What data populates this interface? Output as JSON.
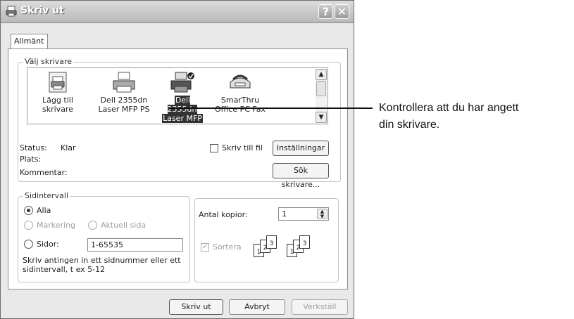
{
  "dialog": {
    "title": "Skriv ut",
    "help_label": "?",
    "close_label": "✕",
    "tab": "Allmänt"
  },
  "select_printer": {
    "legend": "Välj skrivare",
    "printers": [
      {
        "line1": "Lägg till",
        "line2": "skrivare",
        "icon": "add-printer-icon",
        "selected": false
      },
      {
        "line1": "Dell 2355dn",
        "line2": "Laser MFP PS",
        "icon": "printer-icon",
        "selected": false
      },
      {
        "line1": "Dell 2355dn",
        "line2": "Laser MFP",
        "icon": "default-printer-icon",
        "selected": true
      },
      {
        "line1": "SmarThru",
        "line2": "Office PC Fax",
        "icon": "fax-icon",
        "selected": false
      }
    ],
    "status_label": "Status:",
    "status_value": "Klar",
    "location_label": "Plats:",
    "comment_label": "Kommentar:",
    "print_to_file_label": "Skriv till fil",
    "print_to_file_checked": false,
    "preferences_button": "Inställningar",
    "find_printer_button": "Sök skrivare..."
  },
  "page_range": {
    "legend": "Sidintervall",
    "all_label": "Alla",
    "selection_label": "Markering",
    "current_page_label": "Aktuell sida",
    "pages_label": "Sidor:",
    "pages_value": "1-65535",
    "selected_option": "Alla",
    "hint": "Skriv antingen in ett sidnummer eller ett sidintervall, t ex 5-12"
  },
  "copies": {
    "label": "Antal kopior:",
    "value": "1",
    "collate_label": "Sortera",
    "collate_checked": true
  },
  "buttons": {
    "print": "Skriv ut",
    "cancel": "Avbryt",
    "apply": "Verkställ"
  },
  "callout": {
    "line1": "Kontrollera att du har angett",
    "line2": "din skrivare."
  }
}
